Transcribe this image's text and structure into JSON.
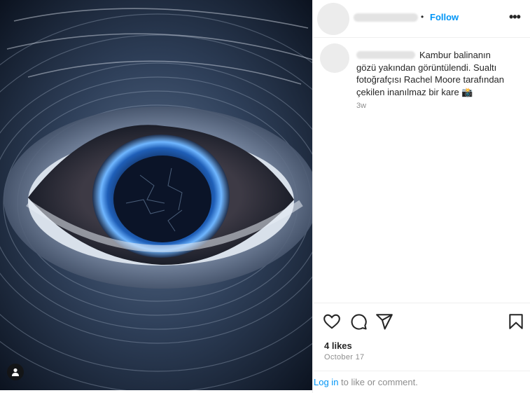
{
  "header": {
    "follow_label": "Follow",
    "separator": "•",
    "more_label": "•••"
  },
  "comment": {
    "text": "Kambur balinanın gözü yakından görüntülendi. Sualtı fotoğrafçısı Rachel Moore tarafından çekilen inanılmaz bir kare 📸",
    "time": "3w"
  },
  "actions": {
    "icons": [
      "heart-icon",
      "comment-icon",
      "share-icon",
      "bookmark-icon"
    ]
  },
  "stats": {
    "likes": "4 likes",
    "date": "October 17"
  },
  "login": {
    "link": "Log in",
    "rest": " to like or comment."
  },
  "colors": {
    "accent": "#0095f6",
    "muted": "#8e8e8e",
    "text": "#262626"
  }
}
